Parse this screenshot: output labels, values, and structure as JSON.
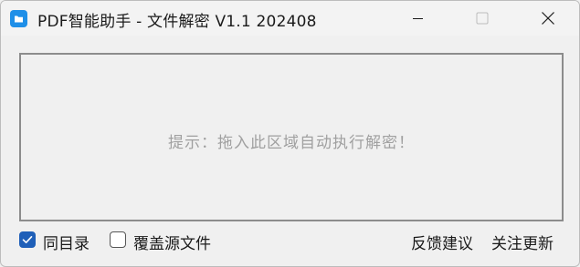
{
  "window": {
    "title": "PDF智能助手 - 文件解密 V1.1 202408",
    "app_icon": "folder-icon",
    "controls": [
      "minimize-icon",
      "maximize-icon",
      "close-icon"
    ]
  },
  "drop_zone": {
    "hint": "提示：拖入此区域自动执行解密！"
  },
  "options": {
    "same_dir": {
      "label": "同目录",
      "checked": true
    },
    "overwrite_source": {
      "label": "覆盖源文件",
      "checked": false
    }
  },
  "links": {
    "feedback": "反馈建议",
    "follow_updates": "关注更新"
  },
  "colors": {
    "checkbox_accent": "#1f5fb8",
    "app_icon": "#1e8fe8",
    "hint_text": "#a0a0a0"
  }
}
